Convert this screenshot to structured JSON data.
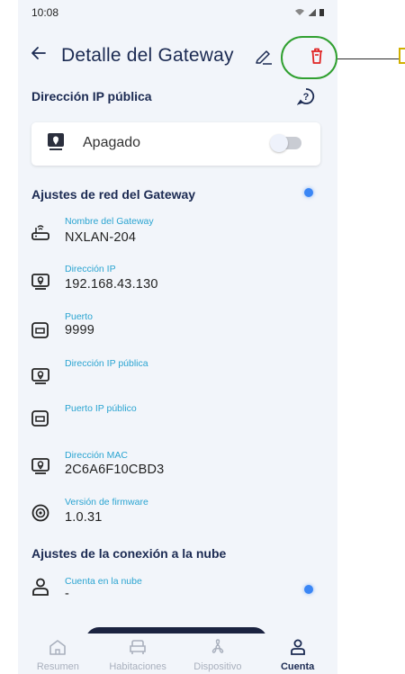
{
  "status_bar": {
    "time": "10:08"
  },
  "header": {
    "title": "Detalle del Gateway"
  },
  "public_ip_section": {
    "title": "Dirección IP pública",
    "toggle_label": "Apagado",
    "toggle_on": false
  },
  "network_section": {
    "title": "Ajustes de red del Gateway",
    "fields": [
      {
        "label": "Nombre del Gateway",
        "value": "NXLAN-204",
        "icon": "router-icon"
      },
      {
        "label": "Dirección IP",
        "value": "192.168.43.130",
        "icon": "location-monitor-icon"
      },
      {
        "label": "Puerto",
        "value": "9999",
        "icon": "port-icon"
      },
      {
        "label": "Dirección IP pública",
        "value": "",
        "icon": "location-monitor-icon"
      },
      {
        "label": "Puerto IP público",
        "value": "",
        "icon": "port-icon"
      },
      {
        "label": "Dirección MAC",
        "value": "2C6A6F10CBD3",
        "icon": "location-monitor-icon"
      },
      {
        "label": "Versión de firmware",
        "value": "1.0.31",
        "icon": "firmware-icon"
      }
    ]
  },
  "cloud_section": {
    "title": "Ajustes de la conexión a la nube",
    "fields": [
      {
        "label": "Cuenta en la nube",
        "value": "-",
        "icon": "user-icon"
      }
    ]
  },
  "bottom_nav": [
    {
      "label": "Resumen",
      "icon": "home-icon",
      "active": false
    },
    {
      "label": "Habitaciones",
      "icon": "sofa-icon",
      "active": false
    },
    {
      "label": "Dispositivo",
      "icon": "fan-icon",
      "active": false
    },
    {
      "label": "Cuenta",
      "icon": "user-icon",
      "active": true
    }
  ],
  "colors": {
    "primary": "#1b2a52",
    "label_accent": "#2aa4d1",
    "delete": "#e02424",
    "indicator": "#3a86f5",
    "highlight": "#30a030"
  }
}
